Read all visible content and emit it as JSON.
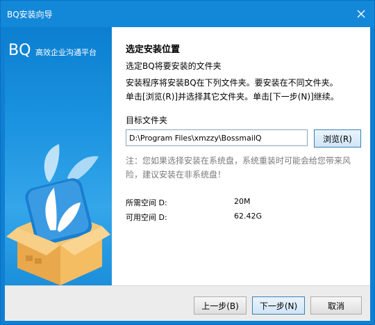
{
  "window": {
    "title": "BQ安装向导"
  },
  "sidebar": {
    "brand": "BQ",
    "slogan": "高效企业沟通平台"
  },
  "main": {
    "heading": "选定安装位置",
    "subheading": "选定BQ将要安装的文件夹",
    "description_line1": "安装程序将安装BQ在下列文件夹。要安装在不同文件夹。",
    "description_line2": "单击[浏览(R)]并选择其它文件夹。单击[下一步(N)]继续。",
    "target_folder_label": "目标文件夹",
    "install_path": "D:\\Program Files\\xmzzy\\BossmailQ",
    "browse_label": "浏览(R)",
    "note": "注：您如果选择安装在系统盘，系统重装时可能会给您带来风险，建议安装在非系统盘！",
    "required_space_label": "所需空间 D:",
    "required_space_value": "20M",
    "available_space_label": "可用空间 D:",
    "available_space_value": "62.42G"
  },
  "footer": {
    "back_label": "上一步(B)",
    "next_label": "下一步(N)",
    "cancel_label": "取消"
  },
  "colors": {
    "titlebar": "#1488d8",
    "sidebar": "#1a92df",
    "box": "#f0b75a",
    "bird": "#2f8fd8"
  },
  "icons": {
    "close": "close-icon",
    "illustration": "bq-box-bird-illustration"
  }
}
